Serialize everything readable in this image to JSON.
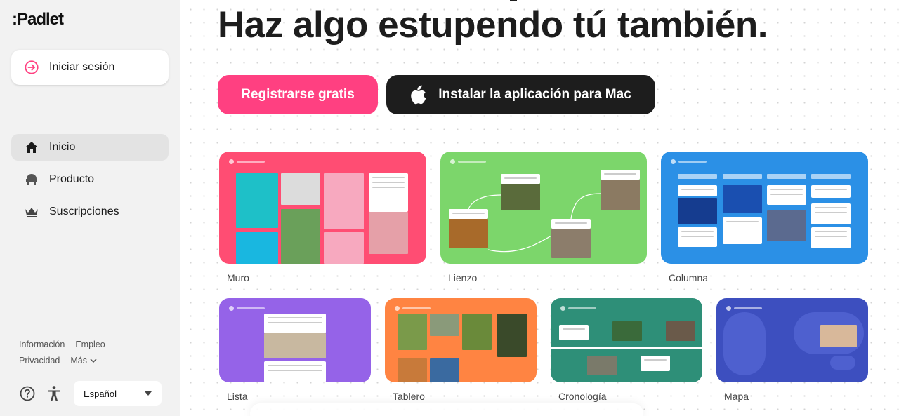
{
  "sidebar": {
    "logo": ":Padlet",
    "signin_label": "Iniciar sesión",
    "nav": [
      {
        "label": "Inicio",
        "icon": "home-icon"
      },
      {
        "label": "Producto",
        "icon": "product-icon"
      },
      {
        "label": "Suscripciones",
        "icon": "crown-icon"
      }
    ],
    "footer_links": [
      "Información",
      "Empleo",
      "Privacidad",
      "Más"
    ],
    "language": "Español"
  },
  "main": {
    "headline": "Haz algo estupendo tú también.",
    "register_button": "Registrarse gratis",
    "mac_button": "Instalar la aplicación para Mac",
    "formats": [
      {
        "label": "Muro",
        "color": "#ff4d73"
      },
      {
        "label": "Lienzo",
        "color": "#7cd66b"
      },
      {
        "label": "Columna",
        "color": "#2b90e6"
      },
      {
        "label": "Lista",
        "color": "#9563e8"
      },
      {
        "label": "Tablero",
        "color": "#ff8442"
      },
      {
        "label": "Cronología",
        "color": "#2e8f78"
      },
      {
        "label": "Mapa",
        "color": "#3d4fbf"
      }
    ]
  },
  "colors": {
    "accent": "#ff4081",
    "dark": "#1d1d1d",
    "sidebar_bg": "#f2f2f2"
  }
}
